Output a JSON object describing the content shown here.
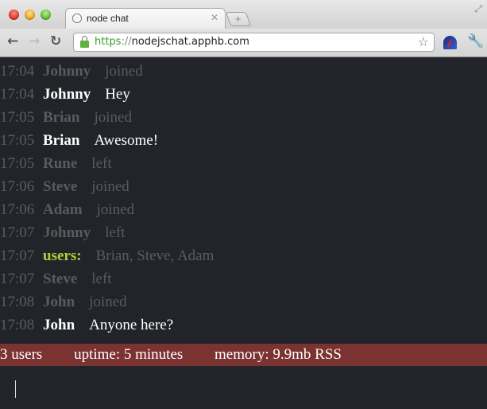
{
  "browser": {
    "tab": {
      "title": "node chat",
      "icon": "globe-icon",
      "close_icon": "close-icon"
    },
    "new_tab_icon": "plus-icon",
    "fullscreen_icon": "fullscreen-icon",
    "nav": {
      "back_icon": "←",
      "forward_icon": "→",
      "reload_icon": "↻"
    },
    "url": {
      "scheme": "https",
      "separator": "://",
      "host": "nodejschat.apphb.com"
    },
    "star_icon": "☆",
    "wrench_icon": "🔧"
  },
  "chat": {
    "messages": [
      {
        "time": "17:04",
        "nick": "Johnny",
        "text": "joined",
        "type": "join"
      },
      {
        "time": "17:04",
        "nick": "Johnny",
        "text": "Hey",
        "type": "chat"
      },
      {
        "time": "17:05",
        "nick": "Brian",
        "text": "joined",
        "type": "join"
      },
      {
        "time": "17:05",
        "nick": "Brian",
        "text": "Awesome!",
        "type": "chat"
      },
      {
        "time": "17:05",
        "nick": "Rune",
        "text": "left",
        "type": "part"
      },
      {
        "time": "17:06",
        "nick": "Steve",
        "text": "joined",
        "type": "join"
      },
      {
        "time": "17:06",
        "nick": "Adam",
        "text": "joined",
        "type": "join"
      },
      {
        "time": "17:07",
        "nick": "Johnny",
        "text": "left",
        "type": "part"
      },
      {
        "time": "17:07",
        "nick": "users:",
        "text": "Brian, Steve, Adam",
        "type": "users"
      },
      {
        "time": "17:07",
        "nick": "Steve",
        "text": "left",
        "type": "part"
      },
      {
        "time": "17:08",
        "nick": "John",
        "text": "joined",
        "type": "join"
      },
      {
        "time": "17:08",
        "nick": "John",
        "text": "Anyone here?",
        "type": "chat"
      }
    ]
  },
  "status": {
    "users": "3 users",
    "uptime": "uptime: 5 minutes",
    "memory": "memory: 9.9mb RSS"
  },
  "colors": {
    "background": "#222429",
    "status_bar": "#7b3332",
    "users_label": "#b4cc3a",
    "dim_text": "#5a5b5d",
    "chat_text": "#ffffff"
  },
  "entry": {
    "value": ""
  }
}
